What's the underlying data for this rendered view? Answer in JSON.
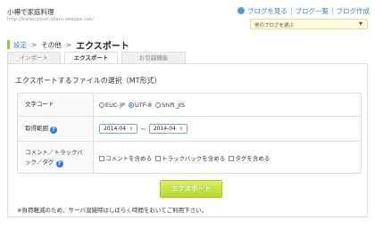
{
  "header": {
    "blog_name": "小樽で家庭料理",
    "blog_url": "http://kateiryouri-otaru.seesaa.net/",
    "view_blog_link": "ブログを見る",
    "blog_list_link": "ブログ一覧",
    "blog_create_link": "ブログ作成",
    "blog_select_placeholder": "他のブログを選ぶ"
  },
  "breadcrumb": {
    "root": "設定",
    "middle": "その他",
    "current": "エクスポート"
  },
  "tabs": [
    "インポート",
    "エクスポート",
    "お引越機能"
  ],
  "active_tab": "エクスポート",
  "panel": {
    "title": "エクスポートするファイルの選択（MT形式）",
    "rows": {
      "charset": {
        "label": "文字コード",
        "options": [
          "EUC-JP",
          "UTF-8",
          "Shift_JIS"
        ],
        "selected": "UTF-8"
      },
      "range": {
        "label": "取得範囲",
        "from": "2014-04",
        "separator": "〜",
        "to": "2014-04"
      },
      "extras": {
        "label": "コメント／トラックバック／タグ",
        "options": [
          "コメントを含める",
          "トラックバックを含める",
          "タグを含める"
        ]
      }
    },
    "export_button": "エクスポート",
    "note": "※負荷軽減のため、サーバ混雑時はしばらく時間をおいてご利用下さい。"
  },
  "icons": {
    "help": "help-icon",
    "globe": "globe-icon"
  },
  "colors": {
    "accent_green": "#b4d92b",
    "link_blue": "#3a7fc4",
    "help_blue": "#2f80d1"
  }
}
